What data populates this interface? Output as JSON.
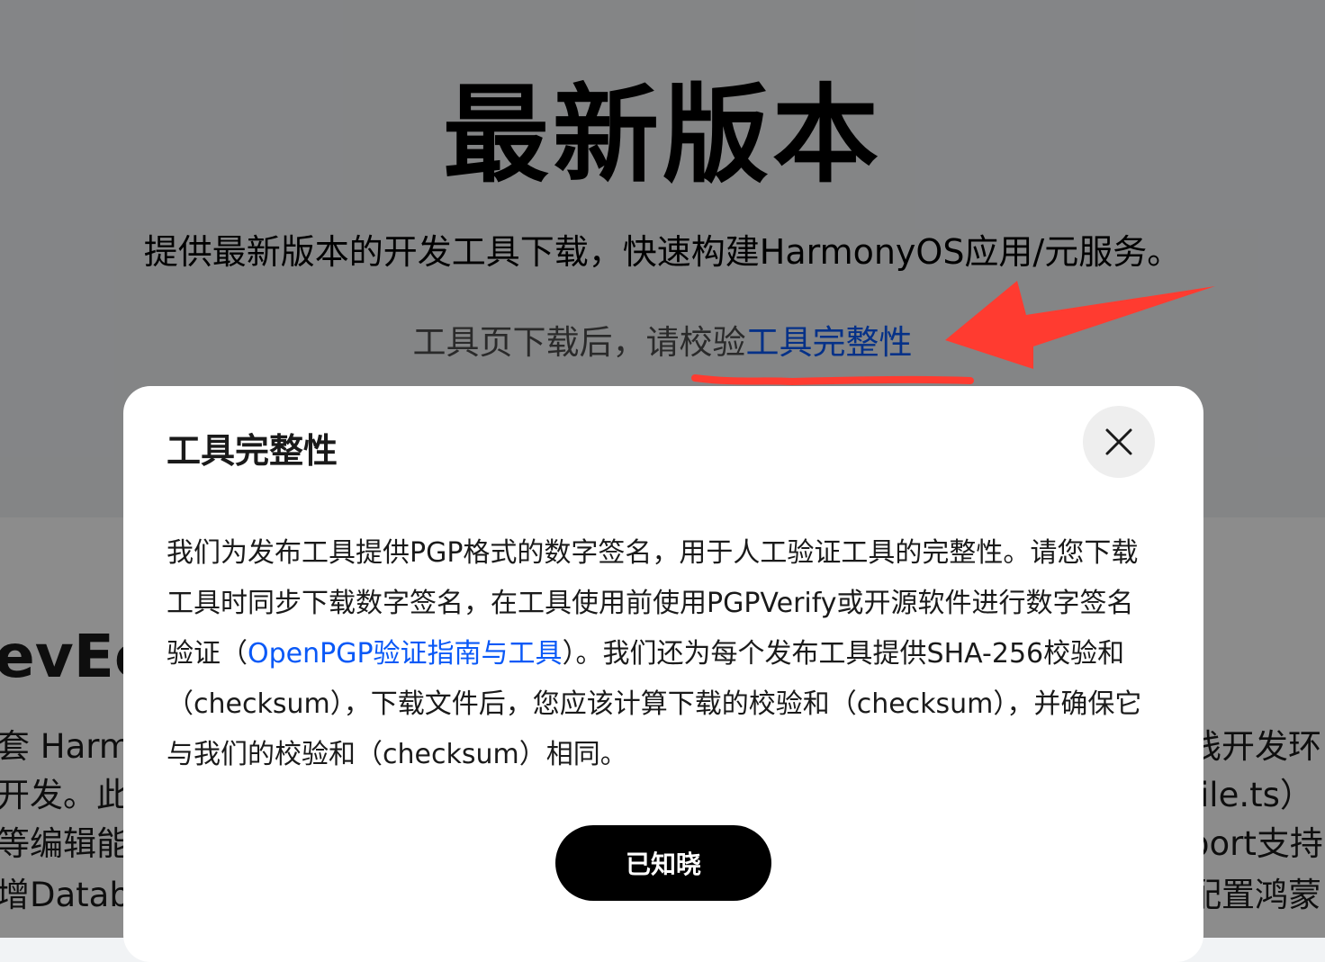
{
  "hero": {
    "title": "最新版本",
    "subtitle": "提供最新版本的开发工具下载，快速构建HarmonyOS应用/元服务。",
    "note_prefix": "工具页下载后，请校验",
    "note_link": "工具完整性"
  },
  "background_fragments": {
    "left": [
      "evEc",
      "套 Harm",
      "开发。此",
      "等编辑能",
      "增Databa"
    ],
    "right": [
      "栈开发环",
      "file.ts）",
      "port支持",
      "配置鸿蒙"
    ]
  },
  "dialog": {
    "title": "工具完整性",
    "body_part1": "我们为发布工具提供PGP格式的数字签名，用于人工验证工具的完整性。请您下载工具时同步下载数字签名，在工具使用前使用PGPVerify或开源软件进行数字签名验证（",
    "body_link": "OpenPGP验证指南与工具",
    "body_part2": "）。我们还为每个发布工具提供SHA-256校验和（checksum），下载文件后，您应该计算下载的校验和（checksum），并确保它与我们的校验和（checksum）相同。",
    "ok_label": "已知晓"
  },
  "icons": {
    "close": "close-icon"
  },
  "colors": {
    "link": "#0a59f7",
    "annotation": "#ff3b30",
    "button": "#000000"
  }
}
